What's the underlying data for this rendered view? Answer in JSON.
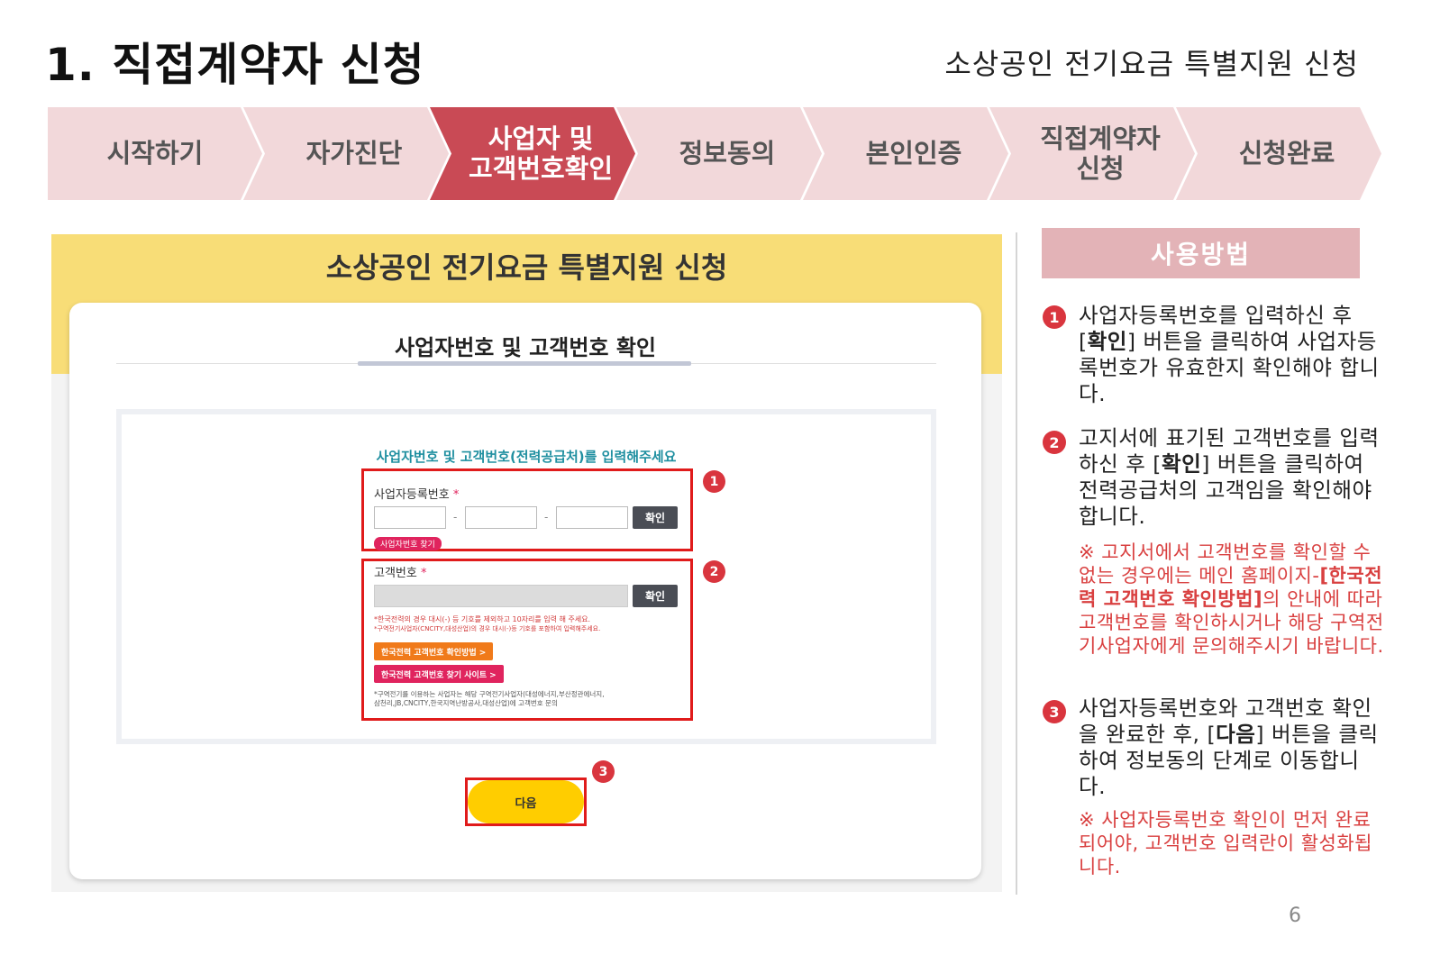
{
  "header": {
    "title": "1. 직접계약자 신청",
    "subtitle": "소상공인 전기요금 특별지원 신청"
  },
  "steps": [
    {
      "label": "시작하기"
    },
    {
      "label": "자가진단"
    },
    {
      "label": "사업자 및\n고객번호확인",
      "active": true
    },
    {
      "label": "정보동의"
    },
    {
      "label": "본인인증"
    },
    {
      "label": "직접계약자\n신청"
    },
    {
      "label": "신청완료"
    }
  ],
  "mock": {
    "banner_title": "소상공인 전기요금 특별지원 신청",
    "card_title": "사업자번호 및 고객번호 확인",
    "instruction": "사업자번호 및 고객번호(전력공급처)를 입력해주세요",
    "business_label": "사업자등록번호",
    "required_mark": "*",
    "dash": "-",
    "confirm_label": "확인",
    "find_business_label": "사업자번호 찾기",
    "customer_label": "고객번호",
    "note1": "*한국전력의 경우 대시(-) 등 기호를 제외하고 10자리를 입력 해 주세요.",
    "note2": "*구역전기사업자(CNCITY,대성산업)의 경우 대시(-)등 기호를 포함하여 입력해주세요.",
    "kepco_method_label": "한국전력 고객번호 확인방법 >",
    "kepco_find_label": "한국전력 고객번호 찾기 사이트 >",
    "note3": "*구역전기를 이용하는 사업자는 해당 구역전기사업자(대성에너지,부산정관에너지,",
    "note4": "삼천리,JB,CNCITY,한국지역난방공사,대성산업)에 고객번호 문의",
    "next_label": "다음",
    "badges": [
      "1",
      "2",
      "3"
    ]
  },
  "usage": {
    "heading": "사용방법",
    "items": [
      {
        "num": "1",
        "pre": "사업자등록번호를 입력하신 후 [",
        "bold": "확인",
        "post": "] 버튼을 클릭하여 사업자등록번호가 유효한지 확인해야 합니다."
      },
      {
        "num": "2",
        "pre": "고지서에 표기된 고객번호를 입력하신 후 [",
        "bold": "확인",
        "post": "] 버튼을 클릭하여 전력공급처의 고객임을 확인해야 합니다."
      },
      {
        "num": "3",
        "pre": "사업자등록번호와 고객번호 확인을 완료한 후, [",
        "bold": "다음",
        "post": "] 버튼을 클릭하여 정보동의 단계로 이동합니다."
      }
    ],
    "warn1": {
      "pre": "※ 고지서에서 고객번호를 확인할 수 없는 경우에는 메인 홈페이지-",
      "bold": "[한국전력 고객번호 확인방법]",
      "post": "의 안내에 따라 고객번호를 확인하시거나 해당 구역전기사업자에게 문의해주시기 바랍니다."
    },
    "warn2": "※ 사업자등록번호 확인이 먼저 완료되어야, 고객번호 입력란이 활성화됩니다."
  },
  "page_number": "6",
  "colors": {
    "accent": "#c94a55",
    "step_bg": "#f2d8da",
    "banner": "#f8dd77",
    "highlight": "#e01b1b",
    "next_button": "#ffcd00"
  }
}
